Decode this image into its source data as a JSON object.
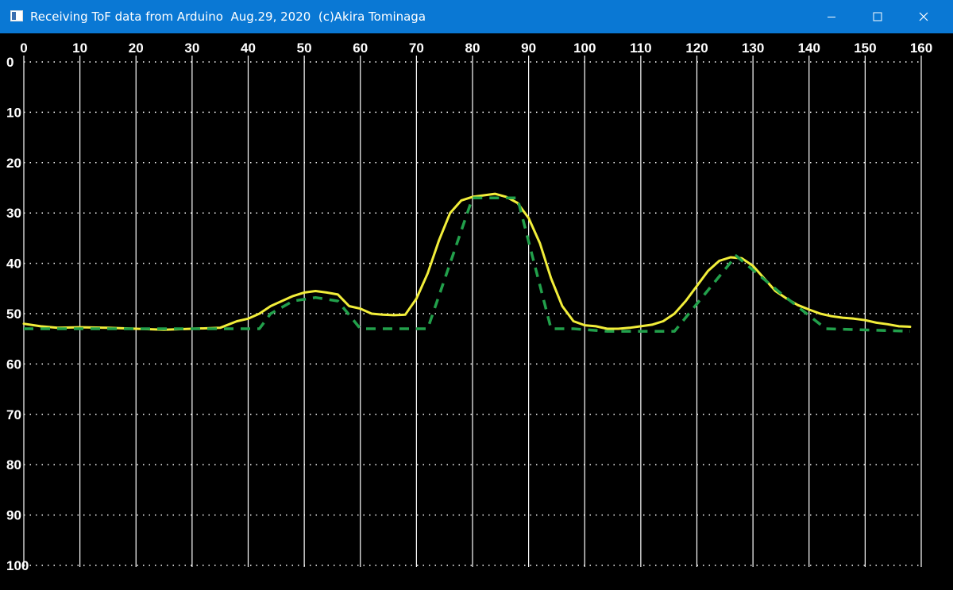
{
  "window": {
    "title": "Receiving ToF data from Arduino  Aug.29, 2020  (c)Akira Tominaga",
    "icons": {
      "app": "window-app-icon",
      "minimize": "minimize-icon",
      "maximize": "maximize-icon",
      "close": "close-icon"
    }
  },
  "colors": {
    "titlebar": "#0a78d4",
    "background": "#000000",
    "grid_major": "#ffffff",
    "grid_minor": "#ffffff",
    "series_raw": "#f2ee3a",
    "series_fit": "#22a04b"
  },
  "chart_data": {
    "type": "line",
    "title": "",
    "xlabel": "",
    "ylabel": "",
    "xlim": [
      0,
      160
    ],
    "ylim": [
      0,
      100
    ],
    "y_inverted": true,
    "x_axis_position": "top",
    "x_ticks": [
      0,
      10,
      20,
      30,
      40,
      50,
      60,
      70,
      80,
      90,
      100,
      110,
      120,
      130,
      140,
      150,
      160
    ],
    "y_ticks": [
      0,
      10,
      20,
      30,
      40,
      50,
      60,
      70,
      80,
      90,
      100
    ],
    "grid": {
      "vertical": "solid",
      "horizontal": "dotted"
    },
    "legend": "none",
    "series": [
      {
        "style": "solid",
        "color": "#f2ee3a",
        "x": [
          0,
          3,
          6,
          10,
          15,
          20,
          25,
          30,
          35,
          38,
          40,
          42,
          44,
          46,
          48,
          50,
          52,
          54,
          56,
          58,
          60,
          62,
          64,
          66,
          68,
          70,
          72,
          74,
          76,
          78,
          80,
          82,
          84,
          86,
          88,
          90,
          92,
          94,
          96,
          98,
          100,
          102,
          104,
          106,
          108,
          110,
          112,
          114,
          116,
          118,
          120,
          122,
          124,
          126,
          128,
          130,
          132,
          134,
          136,
          138,
          140,
          142,
          144,
          146,
          148,
          150,
          152,
          154,
          156,
          158
        ],
        "values": [
          52,
          52.5,
          52.8,
          52.7,
          52.8,
          53,
          53.2,
          53,
          52.8,
          51.5,
          51,
          50,
          48.5,
          47.5,
          46.5,
          45.8,
          45.5,
          45.8,
          46.2,
          48.5,
          49,
          50,
          50.2,
          50.3,
          50.2,
          47,
          42,
          35.5,
          30,
          27.5,
          26.8,
          26.5,
          26.2,
          26.8,
          28,
          31,
          36,
          43,
          48.5,
          51.5,
          52.3,
          52.5,
          53,
          53,
          52.8,
          52.5,
          52.2,
          51.5,
          50,
          47.5,
          44.5,
          41.5,
          39.5,
          38.8,
          39,
          40.5,
          43,
          45.5,
          47,
          48.3,
          49.2,
          50,
          50.5,
          50.8,
          51,
          51.3,
          51.8,
          52.1,
          52.5,
          52.6
        ]
      },
      {
        "style": "dashed",
        "color": "#22a04b",
        "x": [
          0,
          25,
          42,
          44,
          48,
          52,
          56,
          60,
          64,
          72,
          80,
          86,
          88,
          94,
          98,
          104,
          110,
          116,
          127,
          135,
          143,
          158
        ],
        "values": [
          53,
          53,
          53,
          50,
          47.5,
          46.8,
          47.5,
          53,
          53,
          53,
          27,
          27,
          27,
          53,
          53,
          53.5,
          53.5,
          53.5,
          38.5,
          46,
          53,
          53.5
        ]
      }
    ]
  }
}
